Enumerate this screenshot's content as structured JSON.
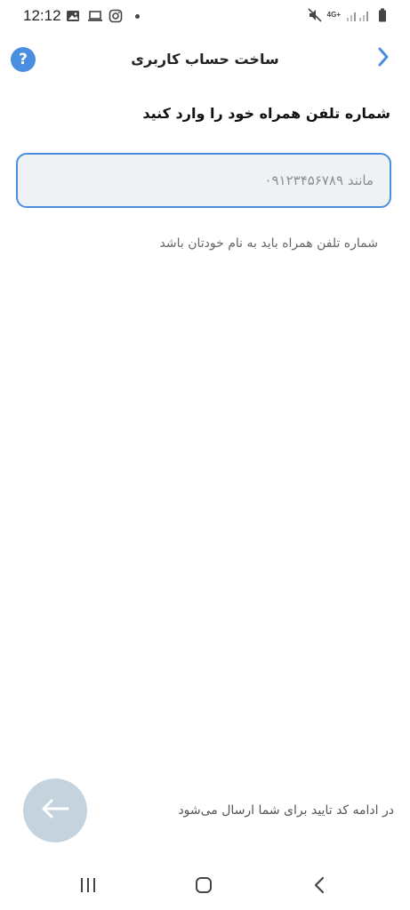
{
  "status_bar": {
    "time": "12:12",
    "network_label": "4G+",
    "icons": [
      "image-icon",
      "laptop-icon",
      "instagram-icon",
      "dot-icon",
      "mute-icon",
      "signal-icon",
      "battery-icon"
    ]
  },
  "header": {
    "title": "ساخت حساب کاربری",
    "help_label": "?",
    "back_icon": "chevron-right-icon"
  },
  "form": {
    "prompt": "شماره تلفن همراه خود را وارد کنید",
    "phone_placeholder": "مانند ۰۹۱۲۳۴۵۶۷۸۹",
    "phone_value": "",
    "hint": "شماره تلفن همراه باید به نام خودتان باشد"
  },
  "footer": {
    "note": "در ادامه کد تایید برای شما ارسال می‌شود",
    "next_icon": "arrow-left-icon"
  },
  "nav_bar": {
    "icons": [
      "recent-apps-icon",
      "home-icon",
      "back-icon"
    ]
  },
  "colors": {
    "accent": "#4a8ee0",
    "input_bg": "#eef2f2",
    "next_button_bg": "#c5d3df"
  }
}
